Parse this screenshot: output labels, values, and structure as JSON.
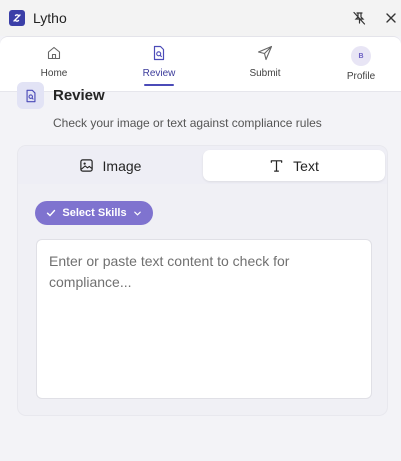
{
  "window": {
    "title": "Lytho",
    "pin_icon": "pin-off-icon",
    "close_icon": "close-icon"
  },
  "nav": {
    "items": [
      {
        "label": "Home",
        "icon": "home-icon"
      },
      {
        "label": "Review",
        "icon": "document-search-icon",
        "active": true
      },
      {
        "label": "Submit",
        "icon": "send-icon"
      },
      {
        "label": "Profile",
        "avatar_initial": "B"
      }
    ]
  },
  "review": {
    "title": "Review",
    "subtitle": "Check your image or text against compliance rules"
  },
  "tabs": {
    "image_label": "Image",
    "text_label": "Text",
    "selected": "Text"
  },
  "skills": {
    "button_label": "Select Skills"
  },
  "input": {
    "placeholder": "Enter or paste text content to check for compliance...",
    "value": ""
  },
  "colors": {
    "accent": "#4b4bb8",
    "skills_button": "#7f73cf",
    "icon_bg": "#e2e3f5"
  }
}
